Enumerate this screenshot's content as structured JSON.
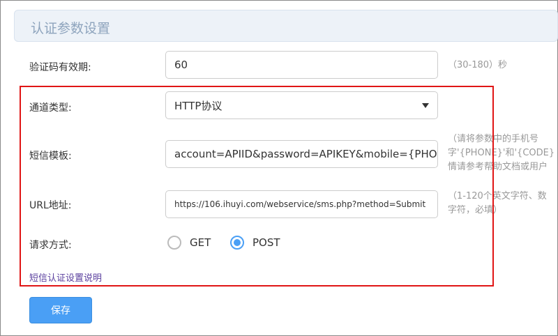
{
  "header": {
    "title": "认证参数设置"
  },
  "validity": {
    "label": "验证码有效期:",
    "value": "60",
    "hint": "（30-180）秒"
  },
  "channel": {
    "label": "通道类型:",
    "value": "HTTP协议"
  },
  "template": {
    "label": "短信模板:",
    "value": "account=APIID&password=APIKEY&mobile={PHONE}&content=",
    "hint_lines": [
      "（请将参数中的手机号",
      "字'{PHONE}'和'{CODE}",
      "情请参考帮助文档或用户"
    ]
  },
  "url": {
    "label": "URL地址:",
    "value": "https://106.ihuyi.com/webservice/sms.php?method=Submit",
    "hint_lines": [
      "（1-120个英文字符、数",
      "字符，必填）"
    ]
  },
  "method": {
    "label": "请求方式:",
    "options": [
      "GET",
      "POST"
    ],
    "selected": "POST"
  },
  "help_link": "短信认证设置说明",
  "save_label": "保存",
  "colors": {
    "accent": "#4a9ff5",
    "highlight": "#e01515"
  }
}
